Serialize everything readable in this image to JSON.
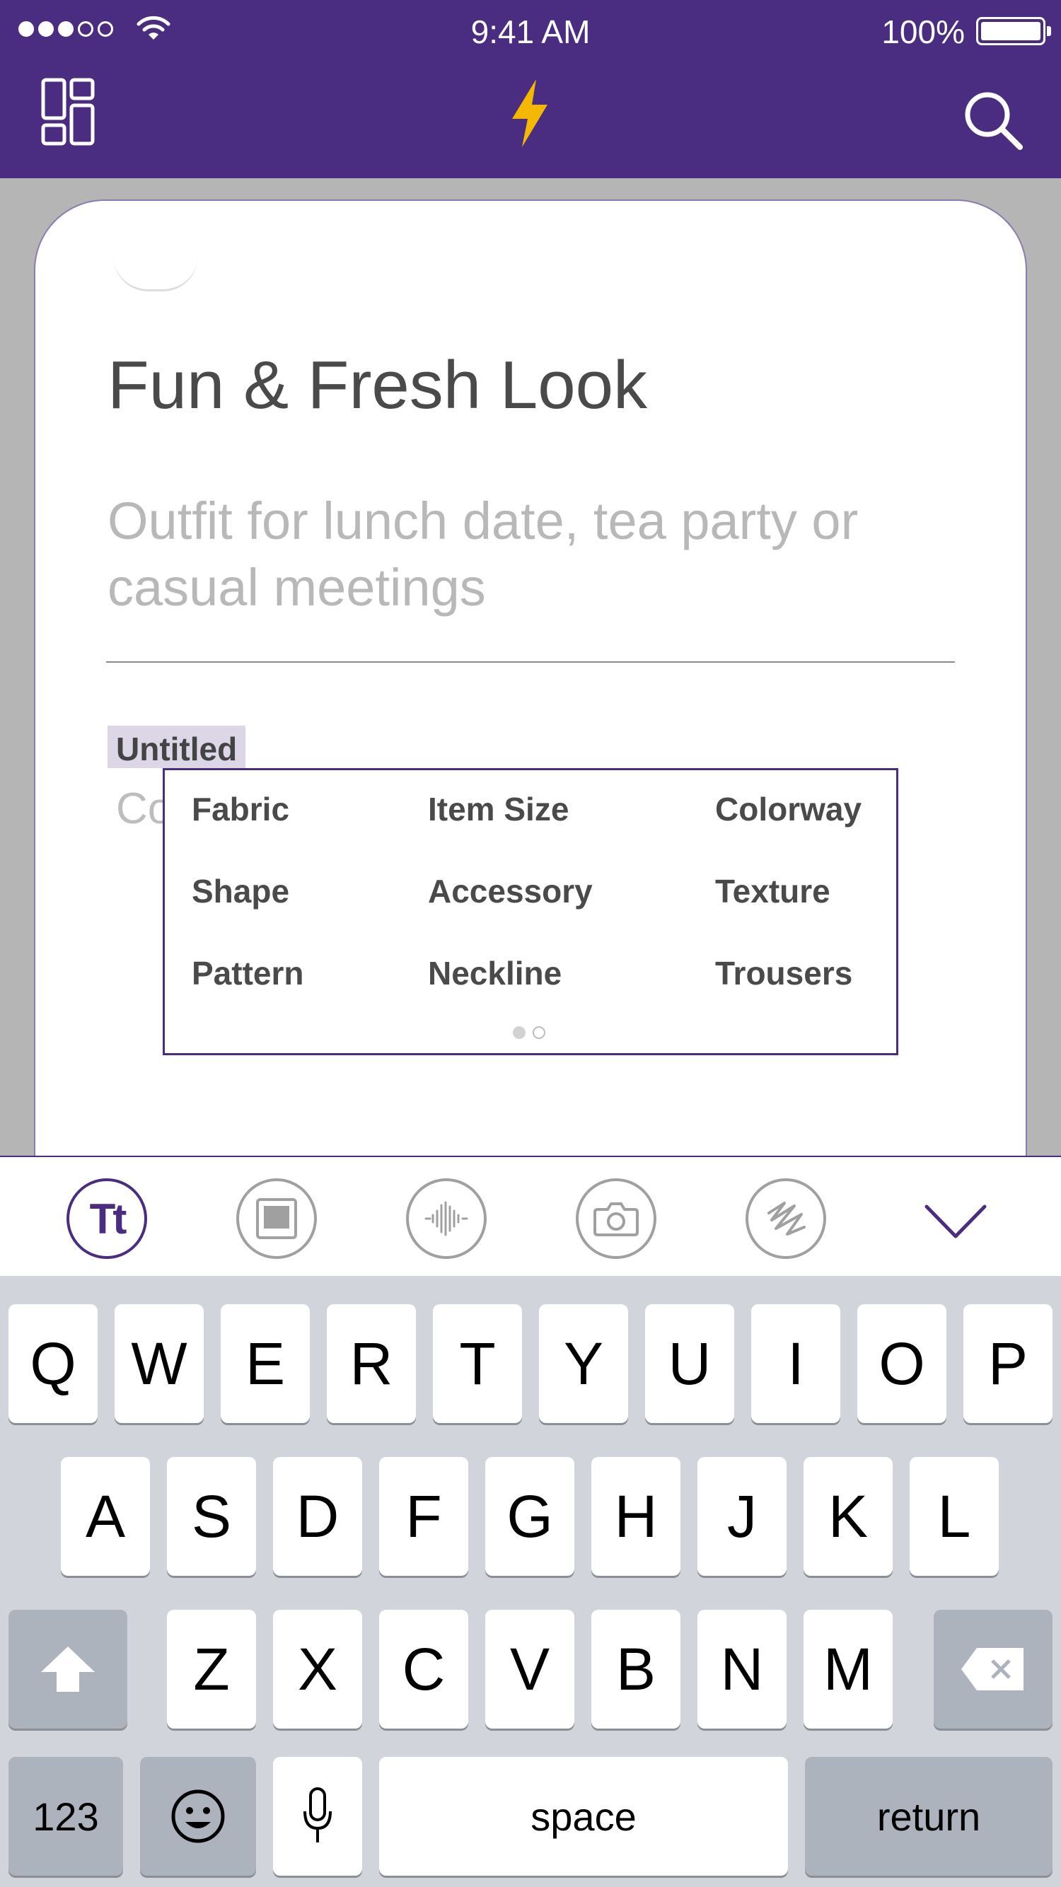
{
  "status_bar": {
    "time": "9:41 AM",
    "battery": "100%"
  },
  "nav": {
    "left_icon": "layout-icon",
    "center_icon": "lightning-bolt-icon",
    "right_icon": "search-icon",
    "accent_color": "#4a2c80",
    "bolt_color": "#f5b800"
  },
  "note": {
    "title": "Fun & Fresh Look",
    "subtitle": "Outfit for lunch date, tea party or casual meetings",
    "section_tag": "Untitled",
    "body_placeholder": "Co"
  },
  "suggestions": {
    "items": [
      "Fabric",
      "Item Size",
      "Colorway",
      "Shape",
      "Accessory",
      "Texture",
      "Pattern",
      "Neckline",
      "Trousers"
    ],
    "pages": 2,
    "current_page": 1
  },
  "toolbar": {
    "text_tool": "Tt",
    "tools": [
      "text-format-icon",
      "image-icon",
      "audio-waveform-icon",
      "camera-icon",
      "scribble-icon"
    ],
    "collapse_icon": "chevron-down-icon"
  },
  "keyboard": {
    "row1": [
      "Q",
      "W",
      "E",
      "R",
      "T",
      "Y",
      "U",
      "I",
      "O",
      "P"
    ],
    "row2": [
      "A",
      "S",
      "D",
      "F",
      "G",
      "H",
      "J",
      "K",
      "L"
    ],
    "row3": [
      "Z",
      "X",
      "C",
      "V",
      "B",
      "N",
      "M"
    ],
    "numbers": "123",
    "space": "space",
    "return": "return",
    "shift_icon": "shift-icon",
    "backspace_icon": "backspace-icon",
    "emoji_icon": "emoji-icon",
    "mic_icon": "microphone-icon"
  }
}
